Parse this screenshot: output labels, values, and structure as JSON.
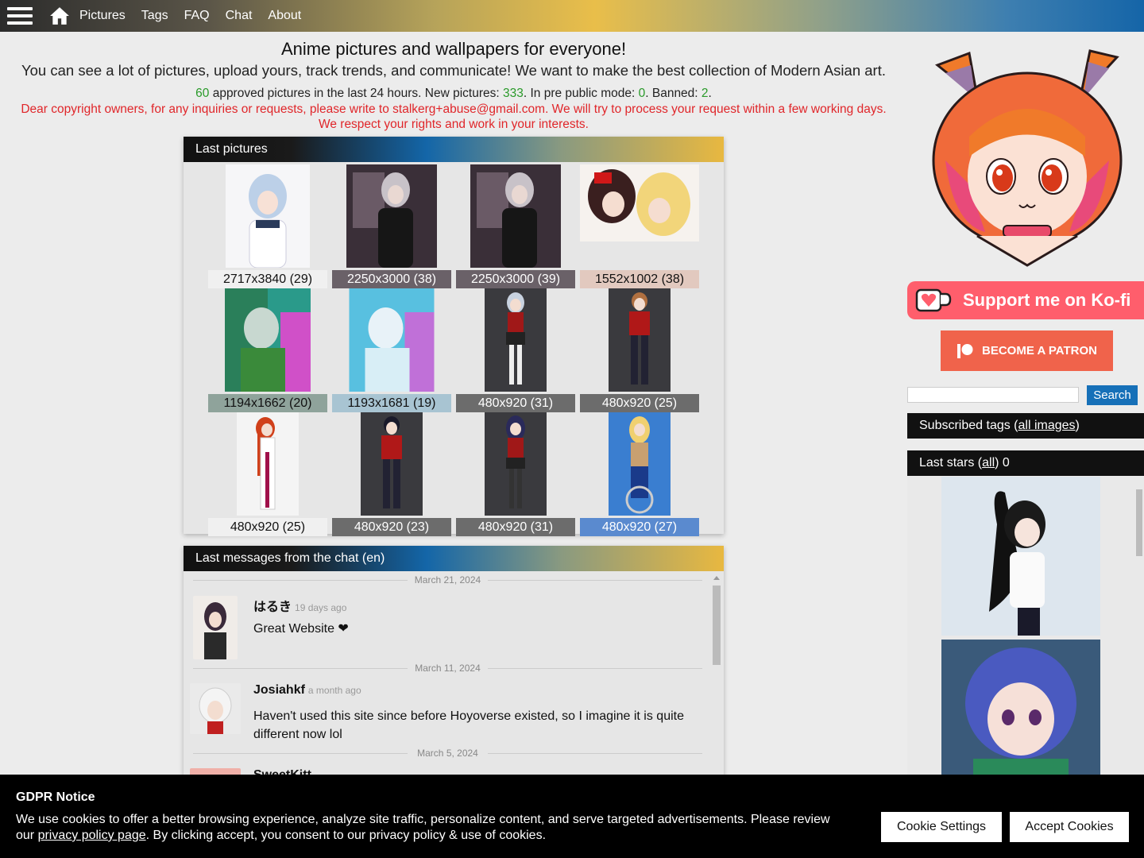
{
  "nav": {
    "links": [
      "Pictures",
      "Tags",
      "FAQ",
      "Chat",
      "About"
    ]
  },
  "intro": {
    "title": "Anime pictures and wallpapers for everyone!",
    "subtitle": "You can see a lot of pictures, upload yours, track trends, and communicate! We want to make the best collection of Modern Asian art.",
    "approved_count": "60",
    "approved_text": " approved pictures in the last 24 hours. New pictures: ",
    "new_count": "333",
    "pre_public_text": ". In pre public mode: ",
    "pre_public_count": "0",
    "banned_text": ". Banned: ",
    "banned_count": "2",
    "end_dot": ".",
    "copyright_line1": "Dear copyright owners, for any inquiries or requests, please write to stalkerg+abuse@gmail.com. We will try to process your request within a few working days.",
    "copyright_line2": "We respect your rights and work in your interests."
  },
  "last_pictures": {
    "title": "Last pictures",
    "items": [
      {
        "caption": "2717x3840 (29)",
        "icon": "anime-girl-white-dress-thumbnail"
      },
      {
        "caption": "2250x3000 (38)",
        "icon": "anime-girl-dark-room-thumbnail"
      },
      {
        "caption": "2250x3000 (39)",
        "icon": "anime-girl-dark-room-thumbnail"
      },
      {
        "caption": "1552x1002 (38)",
        "icon": "two-anime-girls-thumbnail"
      },
      {
        "caption": "1194x1662 (20)",
        "icon": "anime-boy-colorful-thumbnail"
      },
      {
        "caption": "1193x1681 (19)",
        "icon": "anime-boy-colorful-thumbnail"
      },
      {
        "caption": "480x920 (31)",
        "icon": "anime-girl-uniform-thumbnail"
      },
      {
        "caption": "480x920 (25)",
        "icon": "anime-boy-uniform-thumbnail"
      },
      {
        "caption": "480x920 (25)",
        "icon": "anime-girl-red-hair-thumbnail"
      },
      {
        "caption": "480x920 (23)",
        "icon": "anime-boy-uniform-thumbnail"
      },
      {
        "caption": "480x920 (31)",
        "icon": "anime-girl-uniform-thumbnail"
      },
      {
        "caption": "480x920 (27)",
        "icon": "anime-girl-wheelchair-thumbnail"
      }
    ]
  },
  "chat": {
    "title": "Last messages from the chat (en)",
    "dates": [
      "March 21, 2024",
      "March 11, 2024",
      "March 5, 2024"
    ],
    "messages": [
      {
        "name": "はるき",
        "ago": "19 days ago",
        "text": "Great Website ❤"
      },
      {
        "name": "Josiahkf",
        "ago": "a month ago",
        "text": "Haven't used this site since before Hoyoverse existed, so I imagine it is quite different now lol"
      },
      {
        "name": "SweetKitt",
        "ago": "",
        "text": ""
      }
    ]
  },
  "sidebar": {
    "kofi_label": "Support me on Ko-fi",
    "patron_label": "BECOME A PATRON",
    "search_button": "Search",
    "search_placeholder": "",
    "subscribed_prefix": "Subscribed tags (",
    "subscribed_link": "all images",
    "subscribed_suffix": ")",
    "stars_prefix": "Last stars (",
    "stars_link": "all",
    "stars_suffix": ") 0"
  },
  "gdpr": {
    "title": "GDPR Notice",
    "text_before": "We use cookies to offer a better browsing experience, analyze site traffic, personalize content, and serve targeted advertisements. Please review our ",
    "policy_link": "privacy policy page",
    "text_after": ". By clicking accept, you consent to our privacy policy & use of cookies.",
    "settings_button": "Cookie Settings",
    "accept_button": "Accept Cookies"
  },
  "colors": {
    "accent_blue": "#1670b8",
    "kofi_pink": "#ff5e6c",
    "patreon_orange": "#f0634b",
    "stat_green": "#2a9a2a",
    "notice_red": "#e0262a"
  }
}
